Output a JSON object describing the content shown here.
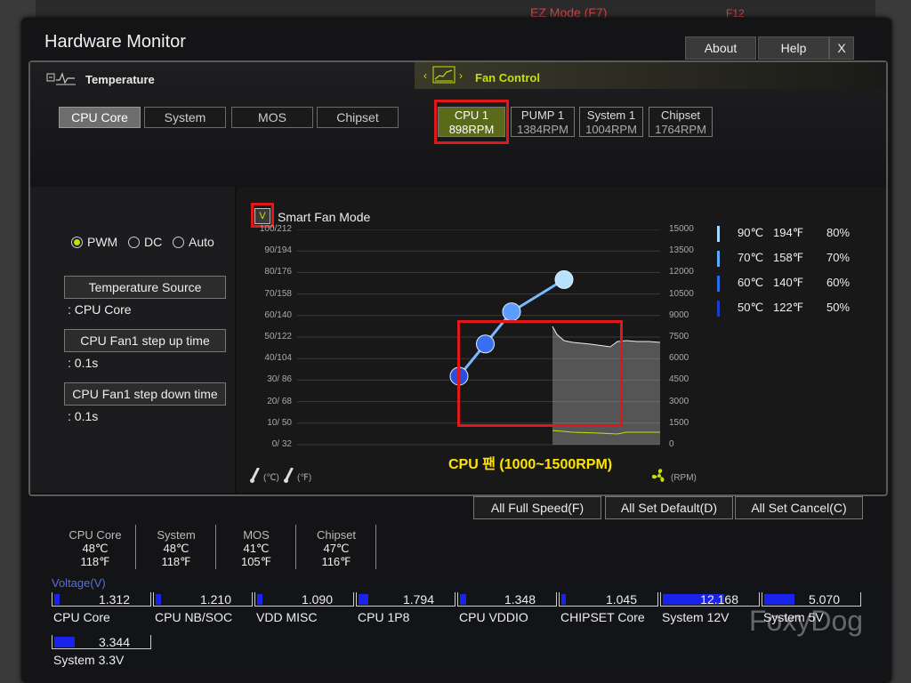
{
  "window": {
    "title": "Hardware Monitor",
    "about_label": "About",
    "help_label": "Help",
    "close_label": "X"
  },
  "background_header": {
    "ez_mode": "EZ Mode (F7)",
    "f12": "F12"
  },
  "temperature": {
    "header": "Temperature",
    "sources": [
      "CPU Core",
      "System",
      "MOS",
      "Chipset"
    ],
    "selected": "CPU Core"
  },
  "fan_control": {
    "header": "Fan Control",
    "prev_icon": "chevron-left-icon",
    "next_icon": "chevron-right-icon",
    "fans": [
      {
        "name": "CPU 1",
        "rpm": "898RPM",
        "active": true
      },
      {
        "name": "PUMP 1",
        "rpm": "1384RPM",
        "active": false
      },
      {
        "name": "System 1",
        "rpm": "1004RPM",
        "active": false
      },
      {
        "name": "Chipset",
        "rpm": "1764RPM",
        "active": false
      }
    ]
  },
  "mode": {
    "options": [
      {
        "label": "PWM",
        "selected": true
      },
      {
        "label": "DC",
        "selected": false
      },
      {
        "label": "Auto",
        "selected": false
      }
    ]
  },
  "left_pane": {
    "temp_source_label": "Temperature Source",
    "temp_source_value": ": CPU Core",
    "step_up_label": "CPU Fan1 step up time",
    "step_up_value": ": 0.1s",
    "step_down_label": "CPU Fan1 step down time",
    "step_down_value": ": 0.1s"
  },
  "smart_fan": {
    "checkbox_mark": "V",
    "label": "Smart Fan Mode",
    "checked": true
  },
  "chart_data": {
    "type": "line",
    "y_left_ticks": [
      "100/212",
      "90/194",
      "80/176",
      "70/158",
      "60/140",
      "50/122",
      "40/104",
      "30/ 86",
      "20/ 68",
      "10/ 50",
      "0/ 32"
    ],
    "y_right_ticks": [
      "15000",
      "13500",
      "12000",
      "10500",
      "9000",
      "7500",
      "6000",
      "4500",
      "3000",
      "1500",
      "0"
    ],
    "left_unit_c": "(℃)",
    "left_unit_f": "(℉)",
    "right_unit": "(RPM)",
    "fan_curve_points": [
      {
        "temp_c": 50,
        "speed_pct": 50
      },
      {
        "temp_c": 60,
        "speed_pct": 60
      },
      {
        "temp_c": 70,
        "speed_pct": 70
      },
      {
        "temp_c": 90,
        "speed_pct": 80
      }
    ],
    "annotation": "CPU 팬 (1000~1500RPM)",
    "legend": [
      {
        "c": "90℃",
        "f": "194℉",
        "pct": "80%",
        "color": "#a8d8ff"
      },
      {
        "c": "70℃",
        "f": "158℉",
        "pct": "70%",
        "color": "#5aaaff"
      },
      {
        "c": "60℃",
        "f": "140℉",
        "pct": "60%",
        "color": "#2a6ef0"
      },
      {
        "c": "50℃",
        "f": "122℉",
        "pct": "50%",
        "color": "#1a3ec8"
      }
    ]
  },
  "actions": {
    "full_speed": "All Full Speed(F)",
    "set_default": "All Set Default(D)",
    "set_cancel": "All Set Cancel(C)"
  },
  "temps": [
    {
      "name": "CPU Core",
      "c": "48℃",
      "f": "118℉"
    },
    {
      "name": "System",
      "c": "48℃",
      "f": "118℉"
    },
    {
      "name": "MOS",
      "c": "41℃",
      "f": "105℉"
    },
    {
      "name": "Chipset",
      "c": "47℃",
      "f": "116℉"
    }
  ],
  "voltage": {
    "title": "Voltage(V)",
    "items": [
      {
        "name": "CPU Core",
        "value": "1.312",
        "fill": 0.06
      },
      {
        "name": "CPU NB/SOC",
        "value": "1.210",
        "fill": 0.06
      },
      {
        "name": "VDD MISC",
        "value": "1.090",
        "fill": 0.06
      },
      {
        "name": "CPU 1P8",
        "value": "1.794",
        "fill": 0.1
      },
      {
        "name": "CPU VDDIO",
        "value": "1.348",
        "fill": 0.07
      },
      {
        "name": "CHIPSET Core",
        "value": "1.045",
        "fill": 0.05
      },
      {
        "name": "System 12V",
        "value": "12.168",
        "fill": 0.65
      },
      {
        "name": "System 5V",
        "value": "5.070",
        "fill": 0.32
      },
      {
        "name": "System 3.3V",
        "value": "3.344",
        "fill": 0.22
      }
    ]
  },
  "watermark": "FoxyDog"
}
